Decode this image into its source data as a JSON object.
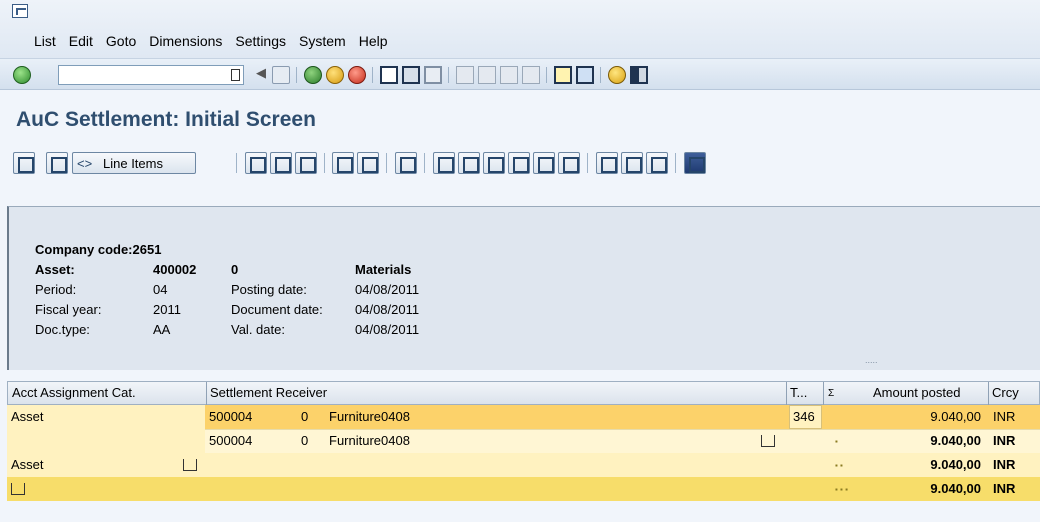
{
  "menu": [
    "List",
    "Edit",
    "Goto",
    "Dimensions",
    "Settings",
    "System",
    "Help"
  ],
  "command_field": {
    "value": ""
  },
  "title": "AuC Settlement: Initial Screen",
  "toolbar": {
    "line_items_label": "Line Items"
  },
  "header": {
    "company_code": "Company code:2651",
    "asset_label": "Asset:",
    "asset_number": "400002",
    "asset_sub": "0",
    "asset_description": "Materials",
    "period_label": "Period:",
    "period_value": "04",
    "posting_date_label": "Posting date:",
    "posting_date_value": "04/08/2011",
    "fiscal_year_label": "Fiscal year:",
    "fiscal_year_value": "2011",
    "document_date_label": "Document date:",
    "document_date_value": "04/08/2011",
    "doctype_label": "Doc.type:",
    "doctype_value": "AA",
    "val_date_label": "Val. date:",
    "val_date_value": "04/08/2011",
    "splitter_dots": "....."
  },
  "table": {
    "columns": {
      "acct_assignment_cat": "Acct Assignment Cat.",
      "settlement_receiver": "Settlement Receiver",
      "t": "T...",
      "sigma": "Σ",
      "amount_posted": "Amount posted",
      "crcy": "Crcy"
    },
    "rows": [
      {
        "category": "Asset",
        "receiver_no": "500004",
        "receiver_sub": "0",
        "receiver_name": "Furniture0408",
        "t": "346",
        "sum_marker": "",
        "amount": "9.040,00",
        "currency": "INR"
      },
      {
        "category": "",
        "receiver_no": "500004",
        "receiver_sub": "0",
        "receiver_name": "Furniture0408",
        "t": "",
        "sum_marker": "▪",
        "amount": "9.040,00",
        "currency": "INR"
      },
      {
        "category": "Asset",
        "receiver_no": "",
        "receiver_sub": "",
        "receiver_name": "",
        "t": "",
        "sum_marker": "▪ ▪",
        "amount": "9.040,00",
        "currency": "INR"
      },
      {
        "category": "",
        "receiver_no": "",
        "receiver_sub": "",
        "receiver_name": "",
        "t": "",
        "sum_marker": "▪ ▪ ▪",
        "amount": "9.040,00",
        "currency": "INR"
      }
    ]
  },
  "colors": {
    "row_total_bg": "#fff2c0",
    "row_selected_bg": "#fcd26a",
    "row_grand_total_bg": "#f7dd6a",
    "title_color": "#2f4e6f"
  }
}
